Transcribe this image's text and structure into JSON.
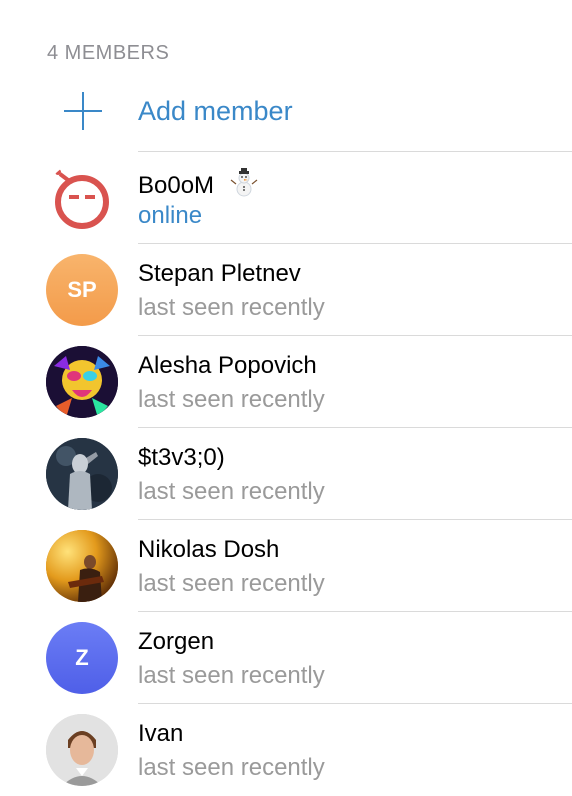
{
  "section": {
    "header": "4 MEMBERS"
  },
  "add_member": {
    "label": "Add member",
    "icon": "plus-icon"
  },
  "accent_color": "#3a88c8",
  "members": [
    {
      "name": "Bo0oM",
      "status": "online",
      "avatar_type": "image",
      "avatar_icon": "bomb-face-icon",
      "badge": "snowman-icon"
    },
    {
      "name": "Stepan Pletnev",
      "status": "last seen recently",
      "avatar_type": "initials",
      "initials": "SP",
      "avatar_color": "#f5a65b"
    },
    {
      "name": "Alesha Popovich",
      "status": "last seen recently",
      "avatar_type": "image"
    },
    {
      "name": "$t3v3;0)",
      "status": "last seen recently",
      "avatar_type": "image"
    },
    {
      "name": "Nikolas Dosh",
      "status": "last seen recently",
      "avatar_type": "image"
    },
    {
      "name": "Zorgen",
      "status": "last seen recently",
      "avatar_type": "initials",
      "initials": "Z",
      "avatar_color": "#5b6ef0"
    },
    {
      "name": "Ivan",
      "status": "last seen recently",
      "avatar_type": "image"
    }
  ]
}
